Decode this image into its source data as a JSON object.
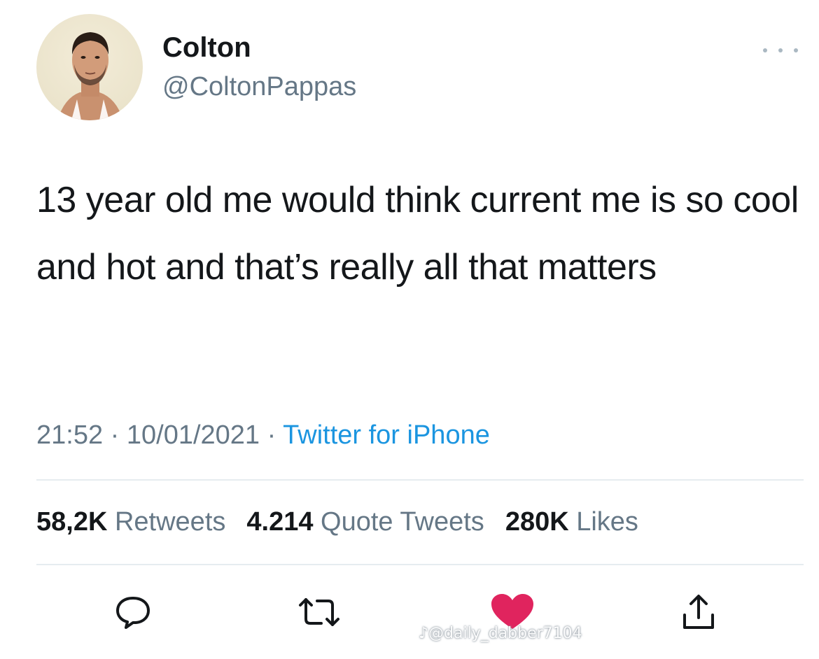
{
  "user": {
    "name": "Colton",
    "handle": "@ColtonPappas"
  },
  "tweet": {
    "text": "13 year old me would think current me is so cool and hot and that’s really all that matters"
  },
  "meta": {
    "time": "21:52",
    "separator1": " · ",
    "date": "10/01/2021",
    "separator2": " · ",
    "source": "Twitter for iPhone"
  },
  "stats": {
    "retweets_count": "58,2K",
    "retweets_label": "Retweets",
    "quotes_count": "4.214",
    "quotes_label": "Quote Tweets",
    "likes_count": "280K",
    "likes_label": "Likes"
  },
  "actions": {
    "reply_icon": "comment-bubble",
    "retweet_icon": "retweet-arrows",
    "like_icon": "heart-filled",
    "share_icon": "share-upload",
    "like_color": "#e0245e"
  },
  "colors": {
    "text": "#14171a",
    "secondary": "#657786",
    "link": "#1b95e0",
    "divider": "#e6ecf0"
  },
  "watermark": {
    "text": "♪@daily_dabber7104"
  }
}
